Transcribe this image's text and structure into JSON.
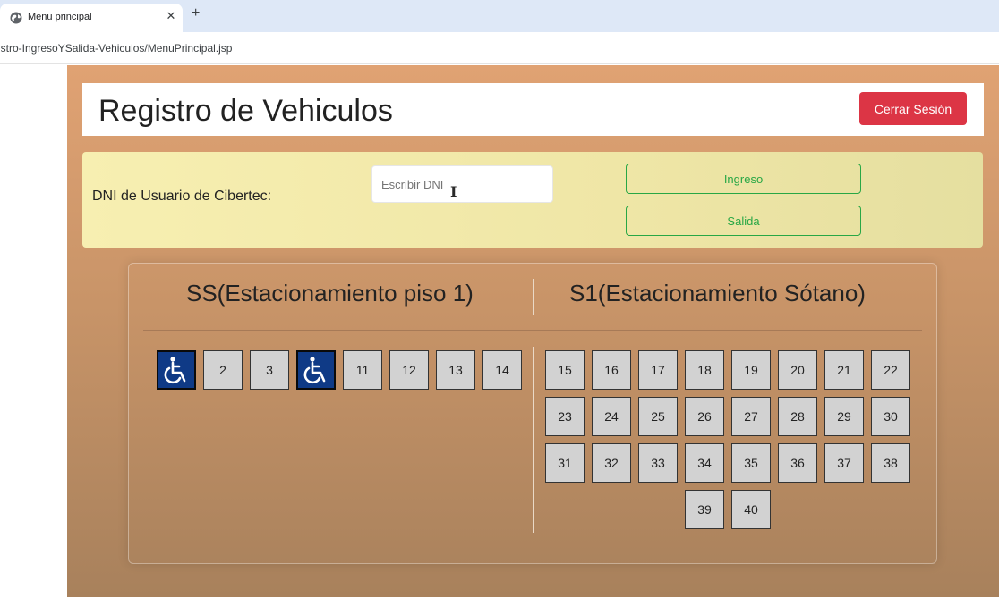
{
  "browser": {
    "tab_title": "Menu principal",
    "tab_close": "✕",
    "new_tab": "+",
    "url": "istro-IngresoYSalida-Vehiculos/MenuPrincipal.jsp"
  },
  "header": {
    "title": "Registro de Vehiculos",
    "logout_label": "Cerrar Sesión"
  },
  "dni_panel": {
    "label": "DNI de Usuario de Cibertec:",
    "input_placeholder": "Escribir DNI",
    "input_value": "",
    "ingreso_label": "Ingreso",
    "salida_label": "Salida"
  },
  "parking": {
    "ss_title": "SS(Estacionamiento piso 1)",
    "s1_title": "S1(Estacionamiento Sótano)",
    "ss_slots": [
      {
        "label": "",
        "icon": "wheelchair-icon"
      },
      {
        "label": "2"
      },
      {
        "label": "3"
      },
      {
        "label": "",
        "icon": "wheelchair-icon"
      },
      {
        "label": "11"
      },
      {
        "label": "12"
      },
      {
        "label": "13"
      },
      {
        "label": "14"
      }
    ],
    "s1_slots": [
      "15",
      "16",
      "17",
      "18",
      "19",
      "20",
      "21",
      "22",
      "23",
      "24",
      "25",
      "26",
      "27",
      "28",
      "29",
      "30",
      "31",
      "32",
      "33",
      "34",
      "35",
      "36",
      "37",
      "38",
      "39",
      "40"
    ]
  },
  "colors": {
    "logout": "#dc3545",
    "outline_green": "#28a745",
    "accessible_blue": "#0f3a86",
    "slot_gray": "#d2d2d2"
  }
}
